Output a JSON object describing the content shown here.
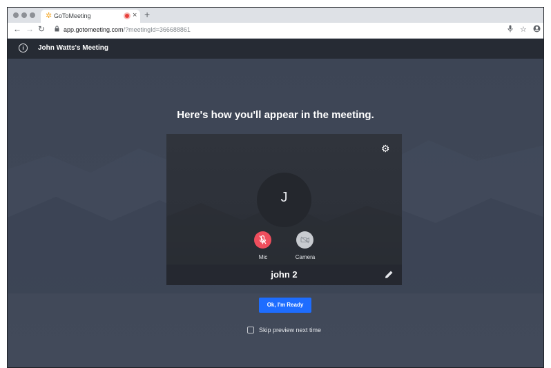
{
  "browser": {
    "tab_title": "GoToMeeting",
    "tab_close": "×",
    "new_tab": "+",
    "url_host": "app.gotomeeting.com",
    "url_rest": "/?meetingId=366688861",
    "icons": [
      "back-arrow-icon",
      "forward-arrow-icon",
      "reload-icon",
      "lock-icon",
      "microphone-icon",
      "star-icon",
      "profile-icon"
    ]
  },
  "header": {
    "info_icon": "i",
    "meeting_title": "John Watts's Meeting"
  },
  "main": {
    "headline": "Here's how you'll appear in the meeting.",
    "avatar_initial": "J",
    "mic_label": "Mic",
    "camera_label": "Camera",
    "mic_state": "muted",
    "camera_state": "off",
    "display_name": "john 2",
    "ready_button": "Ok, I'm Ready",
    "skip_label": "Skip preview next time",
    "skip_checked": false
  },
  "colors": {
    "background": "#3f4756",
    "header": "#262b34",
    "card": "#2b2f36",
    "mic_muted": "#ef4e5d",
    "camera_off": "#c8cbd0",
    "primary_button": "#1e6dff"
  }
}
